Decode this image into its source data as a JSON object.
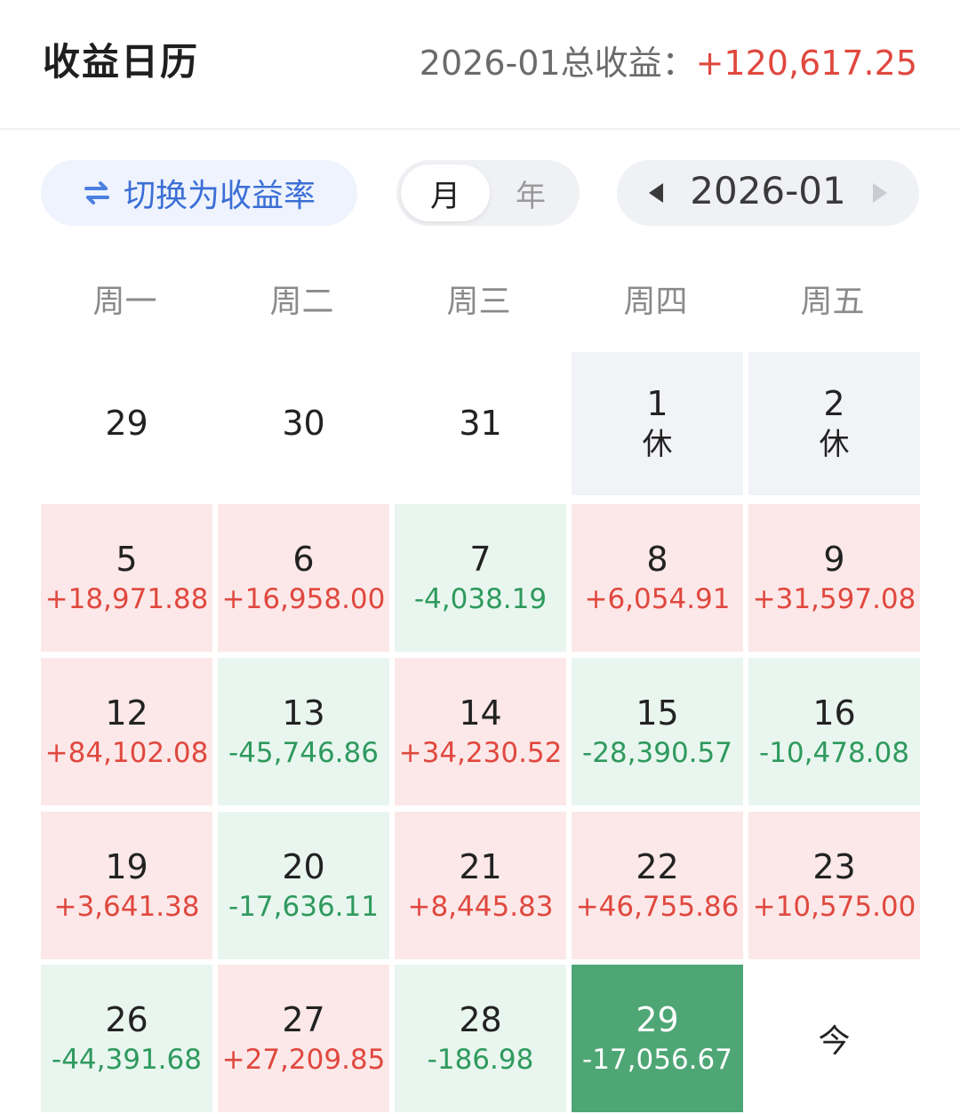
{
  "header": {
    "title": "收益日历",
    "total_label": "2026-01总收益：",
    "total_value": "+120,617.25"
  },
  "toolbar": {
    "switch_label": "切换为收益率",
    "seg_month": "月",
    "seg_year": "年",
    "current_month": "2026-01"
  },
  "weekdays": [
    "周一",
    "周二",
    "周三",
    "周四",
    "周五"
  ],
  "colors": {
    "positive": "#e0483f",
    "negative": "#2f9a5e",
    "positive_bg": "#fce8e8",
    "negative_bg": "#e9f6ef",
    "selected_bg": "#4ea675",
    "accent": "#3c6fd6"
  },
  "calendar": [
    [
      {
        "day": "29",
        "type": "empty"
      },
      {
        "day": "30",
        "type": "empty"
      },
      {
        "day": "31",
        "type": "empty"
      },
      {
        "day": "1",
        "type": "holiday",
        "tag": "休"
      },
      {
        "day": "2",
        "type": "holiday",
        "tag": "休"
      }
    ],
    [
      {
        "day": "5",
        "type": "pos",
        "value": "+18,971.88"
      },
      {
        "day": "6",
        "type": "pos",
        "value": "+16,958.00"
      },
      {
        "day": "7",
        "type": "neg",
        "value": "-4,038.19"
      },
      {
        "day": "8",
        "type": "pos",
        "value": "+6,054.91"
      },
      {
        "day": "9",
        "type": "pos",
        "value": "+31,597.08"
      }
    ],
    [
      {
        "day": "12",
        "type": "pos",
        "value": "+84,102.08"
      },
      {
        "day": "13",
        "type": "neg",
        "value": "-45,746.86"
      },
      {
        "day": "14",
        "type": "pos",
        "value": "+34,230.52"
      },
      {
        "day": "15",
        "type": "neg",
        "value": "-28,390.57"
      },
      {
        "day": "16",
        "type": "neg",
        "value": "-10,478.08"
      }
    ],
    [
      {
        "day": "19",
        "type": "pos",
        "value": "+3,641.38"
      },
      {
        "day": "20",
        "type": "neg",
        "value": "-17,636.11"
      },
      {
        "day": "21",
        "type": "pos",
        "value": "+8,445.83"
      },
      {
        "day": "22",
        "type": "pos",
        "value": "+46,755.86"
      },
      {
        "day": "23",
        "type": "pos",
        "value": "+10,575.00"
      }
    ],
    [
      {
        "day": "26",
        "type": "neg",
        "value": "-44,391.68"
      },
      {
        "day": "27",
        "type": "pos",
        "value": "+27,209.85"
      },
      {
        "day": "28",
        "type": "neg",
        "value": "-186.98"
      },
      {
        "day": "29",
        "type": "today-sel",
        "value": "-17,056.67"
      },
      {
        "day": "今",
        "type": "today-mark"
      }
    ]
  ]
}
